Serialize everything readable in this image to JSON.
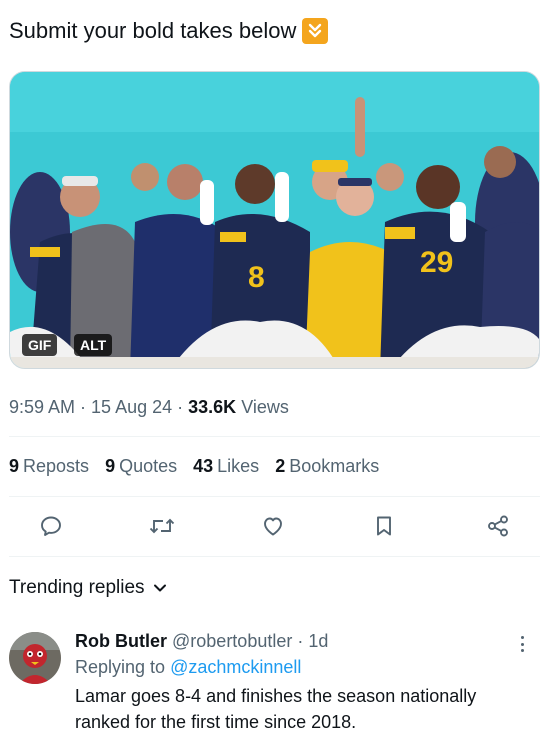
{
  "tweet": {
    "text": "Submit your bold takes below",
    "emoji_icon": "down-arrow-emoji-icon"
  },
  "media": {
    "gif_label": "GIF",
    "alt_label": "ALT",
    "sky_color": "#3cc9d4",
    "jersey_color": "#1e2a52",
    "gold_color": "#f1c21b"
  },
  "meta": {
    "time": "9:59 AM",
    "date": "15 Aug 24",
    "views_count": "33.6K",
    "views_label": "Views"
  },
  "stats": [
    {
      "count": "9",
      "label": "Reposts"
    },
    {
      "count": "9",
      "label": "Quotes"
    },
    {
      "count": "43",
      "label": "Likes"
    },
    {
      "count": "2",
      "label": "Bookmarks"
    }
  ],
  "actions": [
    "reply-icon",
    "repost-icon",
    "like-icon",
    "bookmark-icon",
    "share-icon"
  ],
  "trending": {
    "label": "Trending replies"
  },
  "reply": {
    "name": "Rob Butler",
    "handle": "@robertobutler",
    "separator": "·",
    "time": "1d",
    "replying_prefix": "Replying to",
    "replying_to": "@zachmckinnell",
    "text": "Lamar goes 8-4 and finishes the season nationally ranked for the first time since 2018."
  },
  "colors": {
    "text": "#0f1419",
    "secondary": "#536471",
    "link": "#1d9bf0",
    "divider": "#eff3f4"
  }
}
